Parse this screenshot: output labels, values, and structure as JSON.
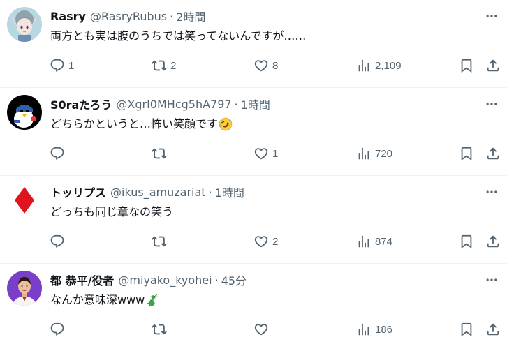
{
  "tweets": [
    {
      "name": "Rasry",
      "handle": "@RasryRubus",
      "dot": "·",
      "time": "2時間",
      "text": "両方とも実は腹のうちでは笑ってないんですが……",
      "emoji": "",
      "replies": "1",
      "retweets": "2",
      "likes": "8",
      "views": "2,109",
      "avatar": "elf-character-avatar"
    },
    {
      "name": "S0raたろう",
      "handle": "@XgrI0MHcg5hA797",
      "dot": "·",
      "time": "1時間",
      "text": "どちらかというと…怖い笑顔です",
      "emoji": "rolling-laughing-emoji",
      "replies": "",
      "retweets": "",
      "likes": "1",
      "views": "720",
      "avatar": "penguin-avatar"
    },
    {
      "name": "トッリプス",
      "handle": "@ikus_amuzariat",
      "dot": "·",
      "time": "1時間",
      "text": "どっちも同じ章なの笑う",
      "emoji": "",
      "replies": "",
      "retweets": "",
      "likes": "2",
      "views": "874",
      "avatar": "red-diamond-avatar"
    },
    {
      "name": "都 恭平/役者",
      "handle": "@miyako_kyohei",
      "dot": "·",
      "time": "45分",
      "text": "なんか意味深www",
      "emoji": "green-dragon-emoji",
      "replies": "",
      "retweets": "",
      "likes": "",
      "views": "186",
      "avatar": "person-photo-avatar"
    }
  ],
  "colors": {
    "text": "#0f1419",
    "secondary": "#536471",
    "divider": "#eff3f4",
    "diamond": "#e0141e"
  }
}
